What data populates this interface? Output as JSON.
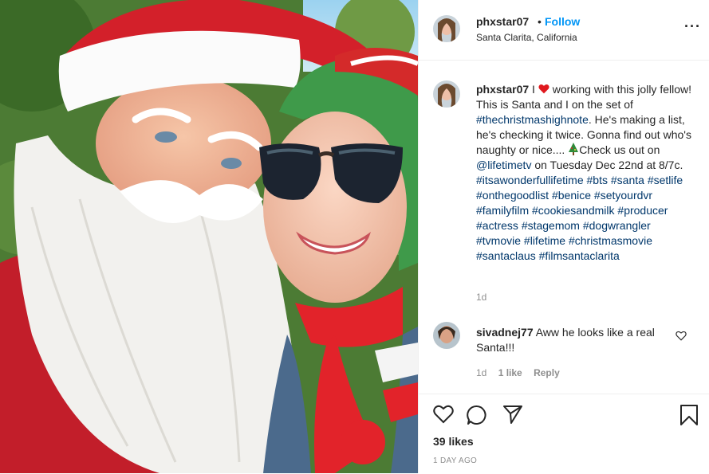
{
  "post": {
    "username": "phxstar07",
    "separator": "•",
    "follow_label": "Follow",
    "location": "Santa Clarita, California",
    "more_icon": "more-options-icon"
  },
  "caption": {
    "username": "phxstar07",
    "text_before_heart": "I",
    "text_part1": "working with this jolly fellow! This is Santa and I on the set of",
    "tag1": "#thechristmashighnote",
    "text_part2": ". He's making a list, he's checking it twice. Gonna find out who's naughty or nice....",
    "text_part3": "Check us out on",
    "mention": "@lifetimetv",
    "text_part4": "on Tuesday Dec 22nd at 8/7c.",
    "tags": [
      "#itsawonderfullifetime",
      "#bts",
      "#santa",
      "#setlife",
      "#onthegoodlist",
      "#benice",
      "#setyourdvr",
      "#familyfilm",
      "#cookiesandmilk",
      "#producer",
      "#actress",
      "#stagemom",
      "#dogwrangler",
      "#tvmovie",
      "#lifetime",
      "#christmasmovie",
      "#santaclaus",
      "#filmsantaclarita"
    ],
    "time": "1d"
  },
  "comment": {
    "username": "sivadnej77",
    "text": "Aww he looks like a real Santa!!!",
    "time": "1d",
    "likes": "1 like",
    "reply_label": "Reply"
  },
  "footer": {
    "likes": "39 likes",
    "date": "1 DAY AGO"
  },
  "colors": {
    "link": "#00376b",
    "follow": "#0095f6",
    "muted": "#8e8e8e",
    "heart": "#e0191e"
  }
}
